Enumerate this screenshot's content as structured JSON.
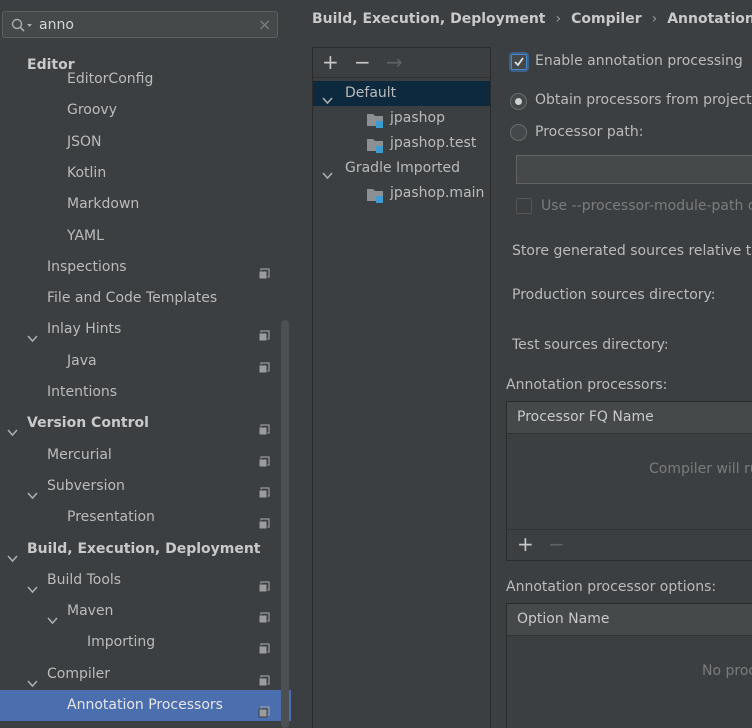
{
  "search": {
    "value": "anno",
    "clear": "×"
  },
  "tree": [
    {
      "label": "Editor",
      "level": 1,
      "bold": true,
      "expanded": null,
      "project": false,
      "selected": false
    },
    {
      "label": "EditorConfig",
      "level": 3,
      "bold": false,
      "expanded": null,
      "project": false,
      "selected": false
    },
    {
      "label": "Groovy",
      "level": 3,
      "bold": false,
      "expanded": null,
      "project": false,
      "selected": false
    },
    {
      "label": "JSON",
      "level": 3,
      "bold": false,
      "expanded": null,
      "project": false,
      "selected": false
    },
    {
      "label": "Kotlin",
      "level": 3,
      "bold": false,
      "expanded": null,
      "project": false,
      "selected": false
    },
    {
      "label": "Markdown",
      "level": 3,
      "bold": false,
      "expanded": null,
      "project": false,
      "selected": false
    },
    {
      "label": "YAML",
      "level": 3,
      "bold": false,
      "expanded": null,
      "project": false,
      "selected": false
    },
    {
      "label": "Inspections",
      "level": 2,
      "bold": false,
      "expanded": null,
      "project": true,
      "selected": false
    },
    {
      "label": "File and Code Templates",
      "level": 2,
      "bold": false,
      "expanded": null,
      "project": false,
      "selected": false
    },
    {
      "label": "Inlay Hints",
      "level": 2,
      "bold": false,
      "expanded": true,
      "project": true,
      "selected": false
    },
    {
      "label": "Java",
      "level": 3,
      "bold": false,
      "expanded": null,
      "project": true,
      "selected": false
    },
    {
      "label": "Intentions",
      "level": 2,
      "bold": false,
      "expanded": null,
      "project": false,
      "selected": false
    },
    {
      "label": "Version Control",
      "level": 1,
      "bold": true,
      "expanded": true,
      "project": true,
      "selected": false
    },
    {
      "label": "Mercurial",
      "level": 2,
      "bold": false,
      "expanded": null,
      "project": true,
      "selected": false
    },
    {
      "label": "Subversion",
      "level": 2,
      "bold": false,
      "expanded": true,
      "project": true,
      "selected": false
    },
    {
      "label": "Presentation",
      "level": 3,
      "bold": false,
      "expanded": null,
      "project": true,
      "selected": false
    },
    {
      "label": "Build, Execution, Deployment",
      "level": 1,
      "bold": true,
      "expanded": true,
      "project": false,
      "selected": false
    },
    {
      "label": "Build Tools",
      "level": 2,
      "bold": false,
      "expanded": true,
      "project": true,
      "selected": false
    },
    {
      "label": "Maven",
      "level": 3,
      "bold": false,
      "expanded": true,
      "project": true,
      "selected": false
    },
    {
      "label": "Importing",
      "level": 4,
      "bold": false,
      "expanded": null,
      "project": true,
      "selected": false
    },
    {
      "label": "Compiler",
      "level": 2,
      "bold": false,
      "expanded": true,
      "project": true,
      "selected": false
    },
    {
      "label": "Annotation Processors",
      "level": 3,
      "bold": false,
      "expanded": null,
      "project": true,
      "selected": true
    }
  ],
  "breadcrumb": [
    "Build, Execution, Deployment",
    "Compiler",
    "Annotation Pro"
  ],
  "profiles_toolbar": {
    "add": "+",
    "remove": "−",
    "move": "→"
  },
  "profiles": [
    {
      "label": "Default",
      "kind": "group",
      "selected": true
    },
    {
      "label": "jpashop",
      "kind": "module",
      "selected": false
    },
    {
      "label": "jpashop.test",
      "kind": "module",
      "selected": false
    },
    {
      "label": "Gradle Imported",
      "kind": "group",
      "selected": false
    },
    {
      "label": "jpashop.main",
      "kind": "module",
      "selected": false
    }
  ],
  "options": {
    "enable_label": "Enable annotation processing",
    "enable_checked": true,
    "obtain_label": "Obtain processors from project",
    "processor_path_label": "Processor path:",
    "module_path_label": "Use --processor-module-path c",
    "store_label": "Store generated sources relative to:",
    "production_label": "Production sources directory:",
    "test_label": "Test sources directory:"
  },
  "processors_table": {
    "title": "Annotation processors:",
    "header": "Processor FQ Name",
    "empty": "Compiler will ru",
    "add": "+",
    "remove": "−"
  },
  "options_table": {
    "title": "Annotation processor options:",
    "header": "Option Name",
    "empty": "No proc"
  }
}
